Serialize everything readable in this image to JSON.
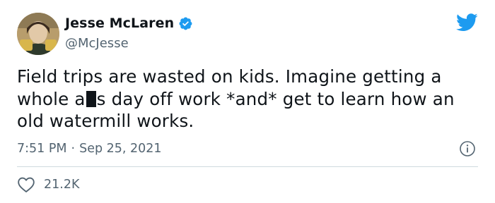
{
  "author": {
    "name": "Jesse McLaren",
    "handle": "@McJesse",
    "avatar_icon": "user-avatar-photo",
    "verified_icon": "verified-badge-icon",
    "verified_color": "#1d9bf0"
  },
  "brand": {
    "logo_icon": "twitter-bird-icon",
    "color": "#1d9bf0"
  },
  "tweet": {
    "text_before_redaction": "Field trips are wasted on kids. Imagine getting a whole a",
    "text_after_redaction": "s day off work *and* get to learn how an old watermill works."
  },
  "meta": {
    "time": "7:51 PM",
    "separator": "·",
    "date": "Sep 25, 2021",
    "info_icon": "info-icon"
  },
  "engagement": {
    "like_icon": "heart-icon",
    "like_count": "21.2K"
  }
}
